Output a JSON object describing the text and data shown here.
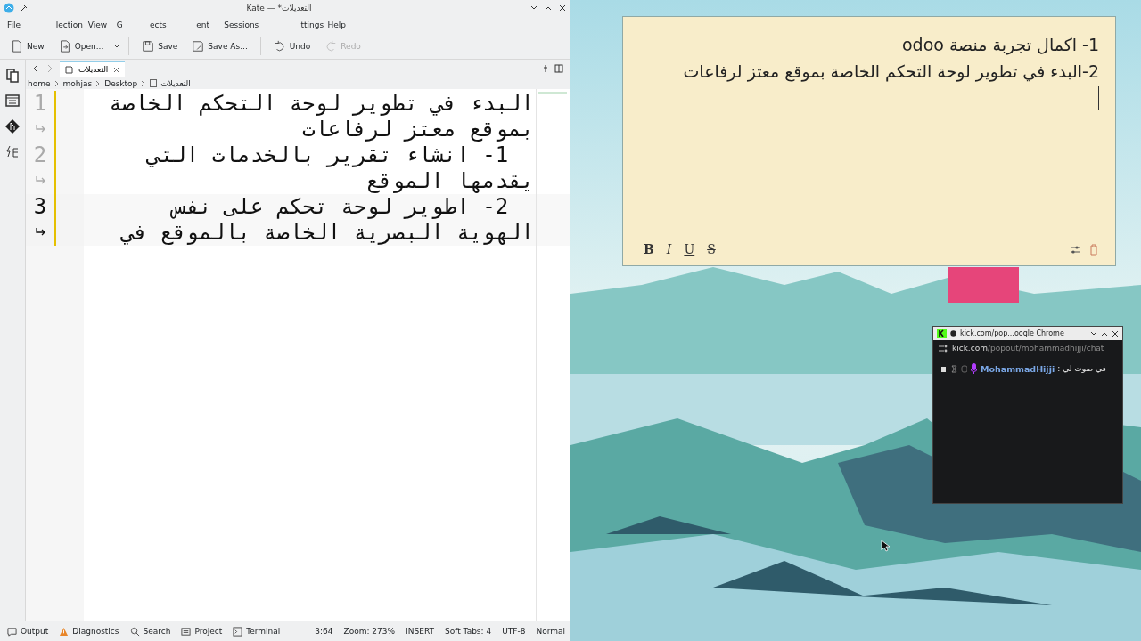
{
  "window": {
    "title": "Kate — *التعديلات"
  },
  "menu": [
    "File",
    "lection",
    "View",
    "G",
    "ects",
    "ent",
    "Sessions",
    "ttings",
    "Help"
  ],
  "toolbar": [
    {
      "kind": "new",
      "label": "New",
      "disabled": false
    },
    {
      "kind": "open",
      "label": "Open...",
      "disabled": false
    },
    {
      "kind": "save",
      "label": "Save",
      "disabled": false
    },
    {
      "kind": "save-as",
      "label": "Save As...",
      "disabled": false
    },
    {
      "kind": "undo",
      "label": "Undo",
      "disabled": false
    },
    {
      "kind": "redo",
      "label": "Redo",
      "disabled": true
    }
  ],
  "tabs": [
    {
      "label": "التعديلات",
      "selected": true
    }
  ],
  "breadcrumb": [
    "home",
    "mohjas",
    "Desktop",
    "التعديلات"
  ],
  "editor": {
    "lines": [
      {
        "number": "1",
        "text": "البدء في تطوير لوحة التحكم الخاصة بموقع معتز لرفاعات",
        "current": false
      },
      {
        "number": "2",
        "text": "  1- انشاء تقرير بالخدمات التي يقدمها الموقع",
        "current": false
      },
      {
        "number": "3",
        "text": "  2- اطوير لوحة تحكم على نفس الهوية البصرية الخاصة بالموقع في",
        "current": true
      }
    ]
  },
  "status_bar": {
    "panels": [
      {
        "kind": "output",
        "label": "Output"
      },
      {
        "kind": "diagnostics",
        "label": "Diagnostics"
      },
      {
        "kind": "search",
        "label": "Search"
      },
      {
        "kind": "project",
        "label": "Project"
      },
      {
        "kind": "terminal",
        "label": "Terminal"
      }
    ],
    "info": [
      "3:64",
      "Zoom: 273%",
      "INSERT",
      "Soft Tabs: 4",
      "UTF-8",
      "Normal"
    ]
  },
  "sticky_note": {
    "lines": [
      "1- اكمال تجربة منصة odoo",
      "2-البدء في تطوير لوحة التحكم الخاصة بموقع معتز لرفاعات"
    ],
    "format_buttons": [
      {
        "kind": "bold",
        "label": "B"
      },
      {
        "kind": "italic",
        "label": "I"
      },
      {
        "kind": "underline",
        "label": "U"
      },
      {
        "kind": "strike",
        "label": "S"
      }
    ]
  },
  "chat_popup": {
    "title": "kick.com/pop...oogle Chrome",
    "url_host": "kick.com",
    "url_path": "/popout/mohammadhijji/chat",
    "messages": [
      {
        "user": "MohammadHijji",
        "separator": ":",
        "text": "في صوت لي"
      }
    ]
  }
}
